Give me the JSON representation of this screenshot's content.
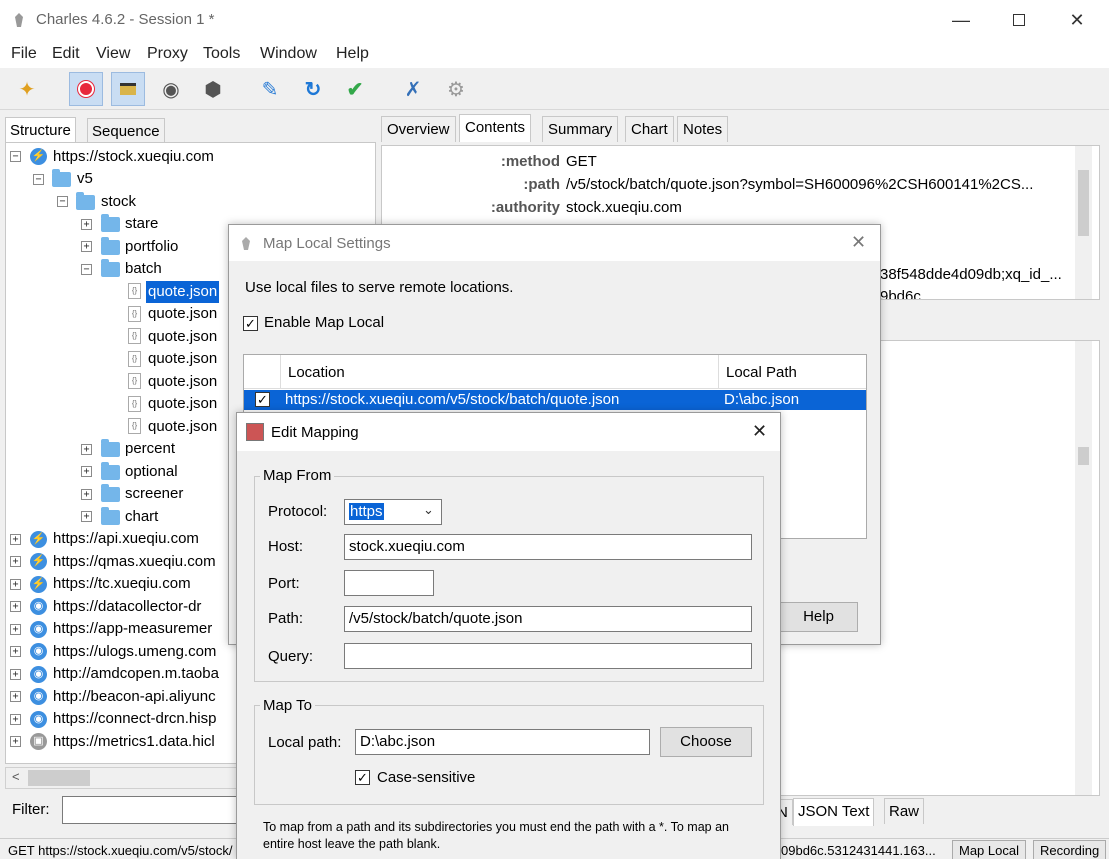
{
  "window": {
    "title": "Charles 4.6.2 - Session 1 *"
  },
  "menu": [
    "File",
    "Edit",
    "View",
    "Proxy",
    "Tools",
    "Window",
    "Help"
  ],
  "left_tabs": {
    "structure": "Structure",
    "sequence": "Sequence"
  },
  "tree": {
    "root": "https://stock.xueqiu.com",
    "v5": "v5",
    "stock": "stock",
    "folders_top": [
      "stare",
      "portfolio"
    ],
    "batch": "batch",
    "files": [
      "quote.json",
      "quote.json",
      "quote.json",
      "quote.json",
      "quote.json",
      "quote.json",
      "quote.json"
    ],
    "folders_bottom": [
      "percent",
      "optional",
      "screener",
      "chart"
    ],
    "hosts": [
      "https://api.xueqiu.com",
      "https://qmas.xueqiu.com",
      "https://tc.xueqiu.com",
      "https://datacollector-dr",
      "https://app-measuremer",
      "https://ulogs.umeng.com",
      "http://amdcopen.m.taoba",
      "http://beacon-api.aliyunc",
      "https://connect-drcn.hisp",
      "https://metrics1.data.hicl"
    ]
  },
  "filter_label": "Filter:",
  "right_tabs": [
    "Overview",
    "Contents",
    "Summary",
    "Chart",
    "Notes"
  ],
  "headers": [
    {
      "key": ":method",
      "value": "GET"
    },
    {
      "key": ":path",
      "value": "/v5/stock/batch/quote.json?symbol=SH600096%2CSH600141%2CS..."
    },
    {
      "key": ":authority",
      "value": "stock.xueqiu.com"
    }
  ],
  "header_fragments": [
    "38f548dde4d09db;xq_id_...",
    "9bd6c"
  ],
  "body_tabs": {
    "json_text": "JSON Text",
    "raw": "Raw",
    "partial": "N"
  },
  "status": {
    "left": "GET https://stock.xueqiu.com/v5/stock/",
    "right": "09bd6c.5312431441.163...",
    "map_local": "Map Local",
    "recording": "Recording"
  },
  "map_local_dialog": {
    "title": "Map Local Settings",
    "description": "Use local files to serve remote locations.",
    "enable_label": "Enable Map Local",
    "columns": {
      "location": "Location",
      "local_path": "Local Path"
    },
    "rows": [
      {
        "location": "https://stock.xueqiu.com/v5/stock/batch/quote.json",
        "local_path": "D:\\abc.json"
      }
    ],
    "help_label": "Help"
  },
  "edit_mapping": {
    "title": "Edit Mapping",
    "map_from": "Map From",
    "protocol_label": "Protocol:",
    "protocol_value": "https",
    "host_label": "Host:",
    "host_value": "stock.xueqiu.com",
    "port_label": "Port:",
    "port_value": "",
    "path_label": "Path:",
    "path_value": "/v5/stock/batch/quote.json",
    "query_label": "Query:",
    "query_value": "",
    "map_to": "Map To",
    "local_path_label": "Local path:",
    "local_path_value": "D:\\abc.json",
    "choose_label": "Choose",
    "case_label": "Case-sensitive",
    "hint": "To map from a path and its subdirectories you must end the path with a *. To map an entire host leave the path blank."
  },
  "colors": {
    "selection": "#0a64d6",
    "accent": "#3d8fe0",
    "folder": "#74b6ea"
  }
}
